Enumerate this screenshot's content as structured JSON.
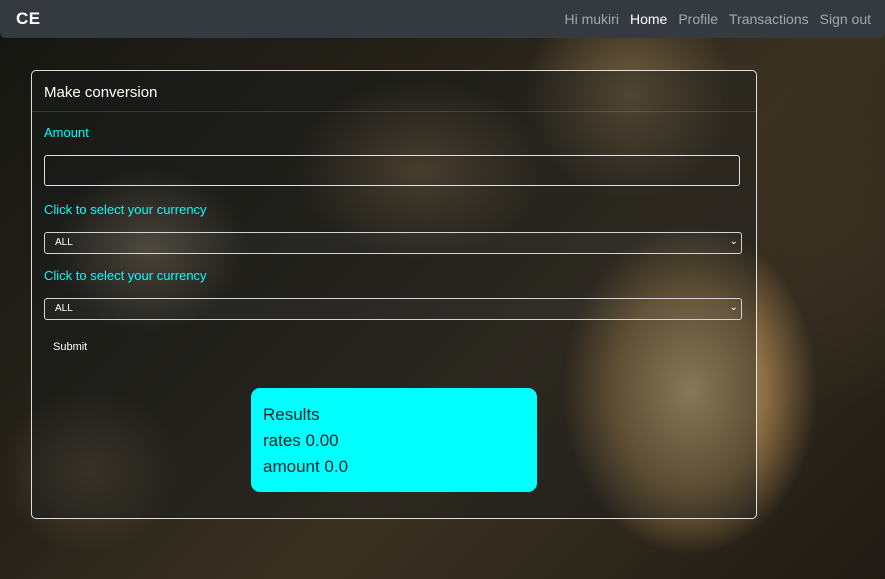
{
  "navbar": {
    "brand": "CE",
    "greeting": "Hi mukiri",
    "links": [
      {
        "label": "Home",
        "active": true
      },
      {
        "label": "Profile",
        "active": false
      },
      {
        "label": "Transactions",
        "active": false
      },
      {
        "label": "Sign out",
        "active": false
      }
    ]
  },
  "form": {
    "title": "Make conversion",
    "amount_label": "Amount",
    "amount_value": "",
    "from_label": "Click to select your currency",
    "from_value": "ALL",
    "to_label": "Click to select your currency",
    "to_value": "ALL",
    "submit_label": "Submit"
  },
  "results": {
    "title": "Results",
    "rates_line": "rates 0.00",
    "amount_line": "amount 0.0"
  },
  "colors": {
    "navbar_bg": "#343a40",
    "label_accent": "#00ffff",
    "results_bg": "#00ffff"
  },
  "icons": {
    "select_arrow": "chevron-down-icon"
  }
}
